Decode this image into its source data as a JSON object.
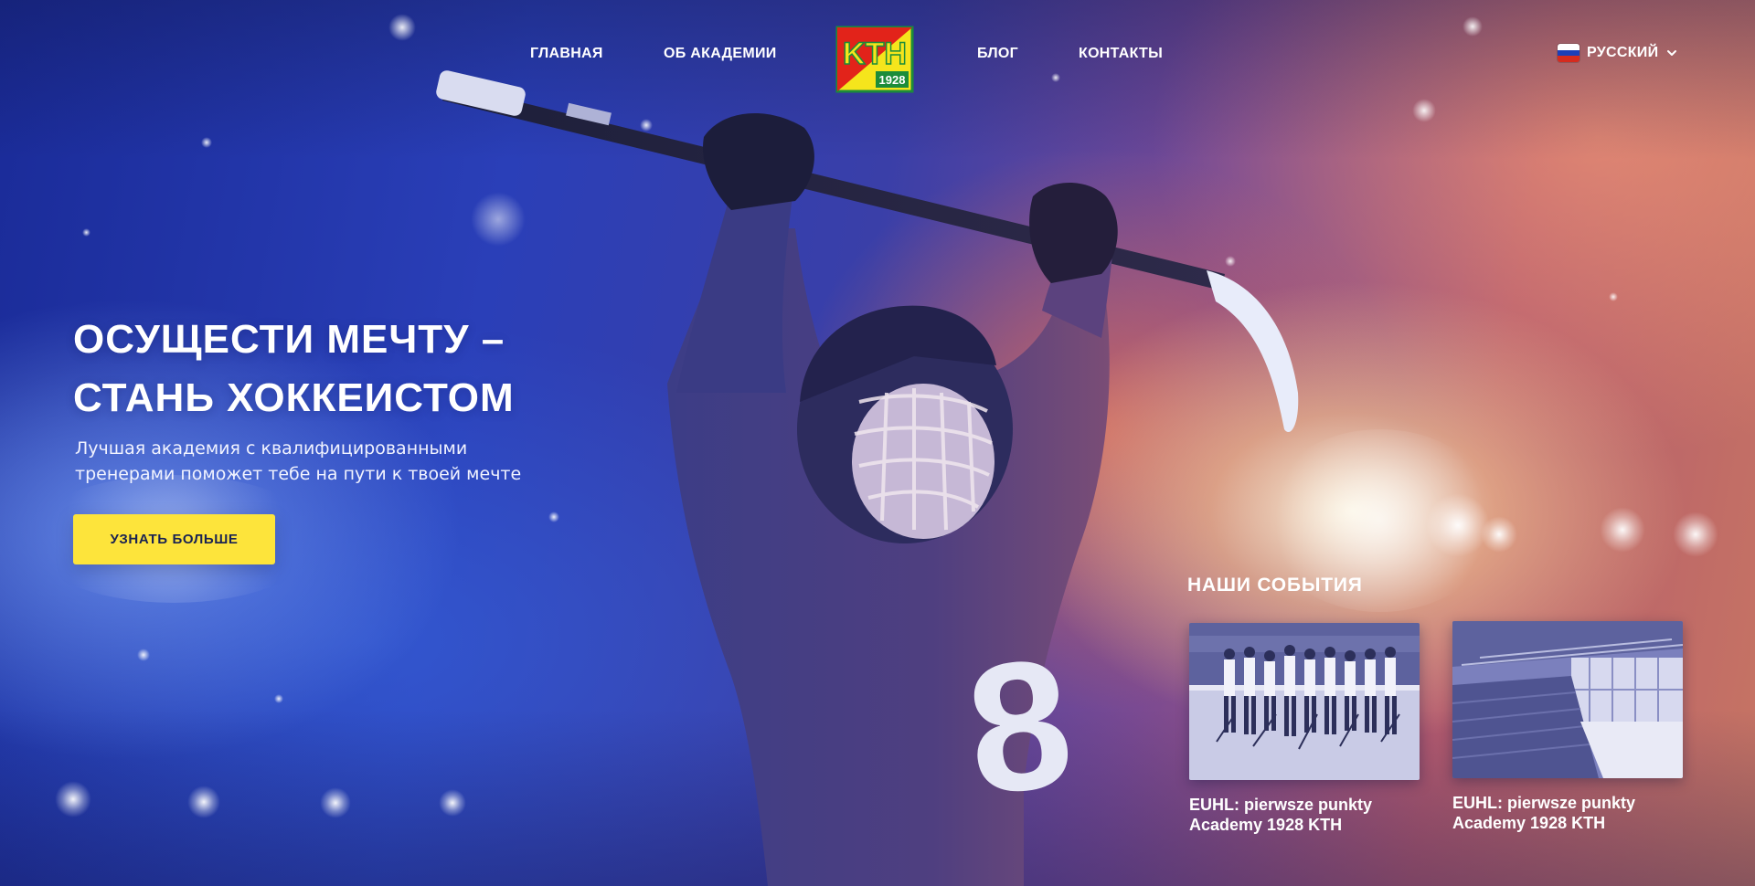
{
  "header": {
    "nav": [
      {
        "label": "ГЛАВНАЯ"
      },
      {
        "label": "ОБ АКАДЕМИИ"
      },
      {
        "label": "БЛОГ"
      },
      {
        "label": "КОНТАКТЫ"
      }
    ],
    "logo": {
      "letters": "KTH",
      "year": "1928",
      "colors": {
        "yellow": "#f5e51c",
        "red": "#e2231a",
        "green": "#1c8c3a"
      }
    },
    "language": {
      "label": "РУССКИЙ",
      "flag": "russia-flag-icon"
    }
  },
  "hero": {
    "title_lines": [
      "ОСУЩЕСТИ МЕЧТУ –",
      "СТАНЬ ХОККЕИСТОМ"
    ],
    "subtitle_lines": [
      "Лучшая академия с квалифицированными",
      "тренерами поможет тебе на пути к твоей мечте"
    ],
    "cta_label": "УЗНАТЬ БОЛЬШЕ",
    "player_number": "8"
  },
  "events": {
    "title": "НАШИ СОБЫТИЯ",
    "items": [
      {
        "title_lines": [
          "EUHL: pierwsze punkty",
          "Academy 1928 KTH"
        ],
        "image": "hockey-team-lineup-photo"
      },
      {
        "title_lines": [
          "EUHL: pierwsze punkty",
          "Academy 1928 KTH"
        ],
        "image": "ice-arena-photo"
      }
    ]
  },
  "colors": {
    "accent_yellow": "#fde43b",
    "cta_text": "#1a2352",
    "background_blue": "#1b2a8c"
  }
}
